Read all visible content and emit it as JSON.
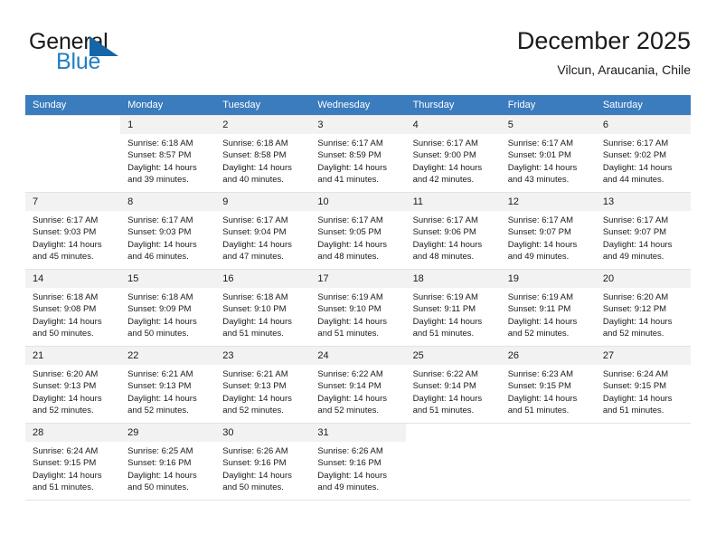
{
  "brand": {
    "name_top": "General",
    "name_bottom": "Blue",
    "triangle_color": "#1565a8",
    "blue_color": "#1f7fc4"
  },
  "header": {
    "title": "December 2025",
    "subtitle": "Vilcun, Araucania, Chile"
  },
  "theme": {
    "header_row_bg": "#3a7cbe",
    "header_row_text": "#ffffff",
    "daynum_bg": "#f2f2f2",
    "grid_line": "#e3e3e3"
  },
  "weekdays": [
    "Sunday",
    "Monday",
    "Tuesday",
    "Wednesday",
    "Thursday",
    "Friday",
    "Saturday"
  ],
  "weeks": [
    [
      {
        "day": "",
        "sunrise": "",
        "sunset": "",
        "daylight_line1": "",
        "daylight_line2": ""
      },
      {
        "day": "1",
        "sunrise": "Sunrise: 6:18 AM",
        "sunset": "Sunset: 8:57 PM",
        "daylight_line1": "Daylight: 14 hours",
        "daylight_line2": "and 39 minutes."
      },
      {
        "day": "2",
        "sunrise": "Sunrise: 6:18 AM",
        "sunset": "Sunset: 8:58 PM",
        "daylight_line1": "Daylight: 14 hours",
        "daylight_line2": "and 40 minutes."
      },
      {
        "day": "3",
        "sunrise": "Sunrise: 6:17 AM",
        "sunset": "Sunset: 8:59 PM",
        "daylight_line1": "Daylight: 14 hours",
        "daylight_line2": "and 41 minutes."
      },
      {
        "day": "4",
        "sunrise": "Sunrise: 6:17 AM",
        "sunset": "Sunset: 9:00 PM",
        "daylight_line1": "Daylight: 14 hours",
        "daylight_line2": "and 42 minutes."
      },
      {
        "day": "5",
        "sunrise": "Sunrise: 6:17 AM",
        "sunset": "Sunset: 9:01 PM",
        "daylight_line1": "Daylight: 14 hours",
        "daylight_line2": "and 43 minutes."
      },
      {
        "day": "6",
        "sunrise": "Sunrise: 6:17 AM",
        "sunset": "Sunset: 9:02 PM",
        "daylight_line1": "Daylight: 14 hours",
        "daylight_line2": "and 44 minutes."
      }
    ],
    [
      {
        "day": "7",
        "sunrise": "Sunrise: 6:17 AM",
        "sunset": "Sunset: 9:03 PM",
        "daylight_line1": "Daylight: 14 hours",
        "daylight_line2": "and 45 minutes."
      },
      {
        "day": "8",
        "sunrise": "Sunrise: 6:17 AM",
        "sunset": "Sunset: 9:03 PM",
        "daylight_line1": "Daylight: 14 hours",
        "daylight_line2": "and 46 minutes."
      },
      {
        "day": "9",
        "sunrise": "Sunrise: 6:17 AM",
        "sunset": "Sunset: 9:04 PM",
        "daylight_line1": "Daylight: 14 hours",
        "daylight_line2": "and 47 minutes."
      },
      {
        "day": "10",
        "sunrise": "Sunrise: 6:17 AM",
        "sunset": "Sunset: 9:05 PM",
        "daylight_line1": "Daylight: 14 hours",
        "daylight_line2": "and 48 minutes."
      },
      {
        "day": "11",
        "sunrise": "Sunrise: 6:17 AM",
        "sunset": "Sunset: 9:06 PM",
        "daylight_line1": "Daylight: 14 hours",
        "daylight_line2": "and 48 minutes."
      },
      {
        "day": "12",
        "sunrise": "Sunrise: 6:17 AM",
        "sunset": "Sunset: 9:07 PM",
        "daylight_line1": "Daylight: 14 hours",
        "daylight_line2": "and 49 minutes."
      },
      {
        "day": "13",
        "sunrise": "Sunrise: 6:17 AM",
        "sunset": "Sunset: 9:07 PM",
        "daylight_line1": "Daylight: 14 hours",
        "daylight_line2": "and 49 minutes."
      }
    ],
    [
      {
        "day": "14",
        "sunrise": "Sunrise: 6:18 AM",
        "sunset": "Sunset: 9:08 PM",
        "daylight_line1": "Daylight: 14 hours",
        "daylight_line2": "and 50 minutes."
      },
      {
        "day": "15",
        "sunrise": "Sunrise: 6:18 AM",
        "sunset": "Sunset: 9:09 PM",
        "daylight_line1": "Daylight: 14 hours",
        "daylight_line2": "and 50 minutes."
      },
      {
        "day": "16",
        "sunrise": "Sunrise: 6:18 AM",
        "sunset": "Sunset: 9:10 PM",
        "daylight_line1": "Daylight: 14 hours",
        "daylight_line2": "and 51 minutes."
      },
      {
        "day": "17",
        "sunrise": "Sunrise: 6:19 AM",
        "sunset": "Sunset: 9:10 PM",
        "daylight_line1": "Daylight: 14 hours",
        "daylight_line2": "and 51 minutes."
      },
      {
        "day": "18",
        "sunrise": "Sunrise: 6:19 AM",
        "sunset": "Sunset: 9:11 PM",
        "daylight_line1": "Daylight: 14 hours",
        "daylight_line2": "and 51 minutes."
      },
      {
        "day": "19",
        "sunrise": "Sunrise: 6:19 AM",
        "sunset": "Sunset: 9:11 PM",
        "daylight_line1": "Daylight: 14 hours",
        "daylight_line2": "and 52 minutes."
      },
      {
        "day": "20",
        "sunrise": "Sunrise: 6:20 AM",
        "sunset": "Sunset: 9:12 PM",
        "daylight_line1": "Daylight: 14 hours",
        "daylight_line2": "and 52 minutes."
      }
    ],
    [
      {
        "day": "21",
        "sunrise": "Sunrise: 6:20 AM",
        "sunset": "Sunset: 9:13 PM",
        "daylight_line1": "Daylight: 14 hours",
        "daylight_line2": "and 52 minutes."
      },
      {
        "day": "22",
        "sunrise": "Sunrise: 6:21 AM",
        "sunset": "Sunset: 9:13 PM",
        "daylight_line1": "Daylight: 14 hours",
        "daylight_line2": "and 52 minutes."
      },
      {
        "day": "23",
        "sunrise": "Sunrise: 6:21 AM",
        "sunset": "Sunset: 9:13 PM",
        "daylight_line1": "Daylight: 14 hours",
        "daylight_line2": "and 52 minutes."
      },
      {
        "day": "24",
        "sunrise": "Sunrise: 6:22 AM",
        "sunset": "Sunset: 9:14 PM",
        "daylight_line1": "Daylight: 14 hours",
        "daylight_line2": "and 52 minutes."
      },
      {
        "day": "25",
        "sunrise": "Sunrise: 6:22 AM",
        "sunset": "Sunset: 9:14 PM",
        "daylight_line1": "Daylight: 14 hours",
        "daylight_line2": "and 51 minutes."
      },
      {
        "day": "26",
        "sunrise": "Sunrise: 6:23 AM",
        "sunset": "Sunset: 9:15 PM",
        "daylight_line1": "Daylight: 14 hours",
        "daylight_line2": "and 51 minutes."
      },
      {
        "day": "27",
        "sunrise": "Sunrise: 6:24 AM",
        "sunset": "Sunset: 9:15 PM",
        "daylight_line1": "Daylight: 14 hours",
        "daylight_line2": "and 51 minutes."
      }
    ],
    [
      {
        "day": "28",
        "sunrise": "Sunrise: 6:24 AM",
        "sunset": "Sunset: 9:15 PM",
        "daylight_line1": "Daylight: 14 hours",
        "daylight_line2": "and 51 minutes."
      },
      {
        "day": "29",
        "sunrise": "Sunrise: 6:25 AM",
        "sunset": "Sunset: 9:16 PM",
        "daylight_line1": "Daylight: 14 hours",
        "daylight_line2": "and 50 minutes."
      },
      {
        "day": "30",
        "sunrise": "Sunrise: 6:26 AM",
        "sunset": "Sunset: 9:16 PM",
        "daylight_line1": "Daylight: 14 hours",
        "daylight_line2": "and 50 minutes."
      },
      {
        "day": "31",
        "sunrise": "Sunrise: 6:26 AM",
        "sunset": "Sunset: 9:16 PM",
        "daylight_line1": "Daylight: 14 hours",
        "daylight_line2": "and 49 minutes."
      },
      {
        "day": "",
        "sunrise": "",
        "sunset": "",
        "daylight_line1": "",
        "daylight_line2": ""
      },
      {
        "day": "",
        "sunrise": "",
        "sunset": "",
        "daylight_line1": "",
        "daylight_line2": ""
      },
      {
        "day": "",
        "sunrise": "",
        "sunset": "",
        "daylight_line1": "",
        "daylight_line2": ""
      }
    ]
  ]
}
